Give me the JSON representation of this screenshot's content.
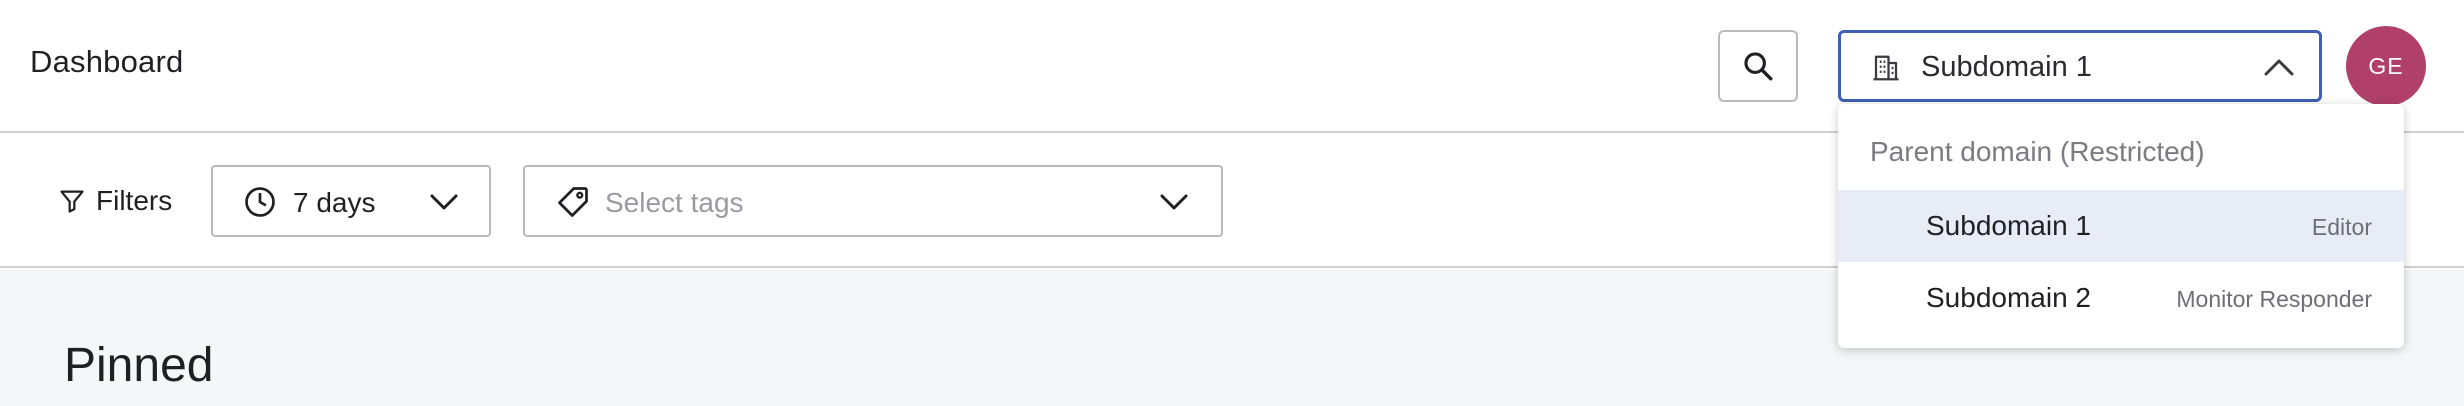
{
  "header": {
    "title": "Dashboard",
    "search_icon": "search-icon",
    "domain_select": {
      "value": "Subdomain 1",
      "icon": "building-icon",
      "state": "open"
    },
    "avatar_initials": "GE",
    "avatar_color": "#b0406a"
  },
  "filters": {
    "label": "Filters",
    "time_range": {
      "value": "7 days"
    },
    "tags": {
      "placeholder": "Select tags"
    }
  },
  "content": {
    "section_title": "Pinned"
  },
  "dropdown": {
    "header": "Parent domain (Restricted)",
    "items": [
      {
        "name": "Subdomain 1",
        "role": "Editor",
        "selected": true
      },
      {
        "name": "Subdomain 2",
        "role": "Monitor Responder",
        "selected": false
      }
    ]
  },
  "colors": {
    "accent": "#3e5fb3",
    "selected_bg": "#e8ecf6",
    "content_bg": "#f5f6f8"
  }
}
